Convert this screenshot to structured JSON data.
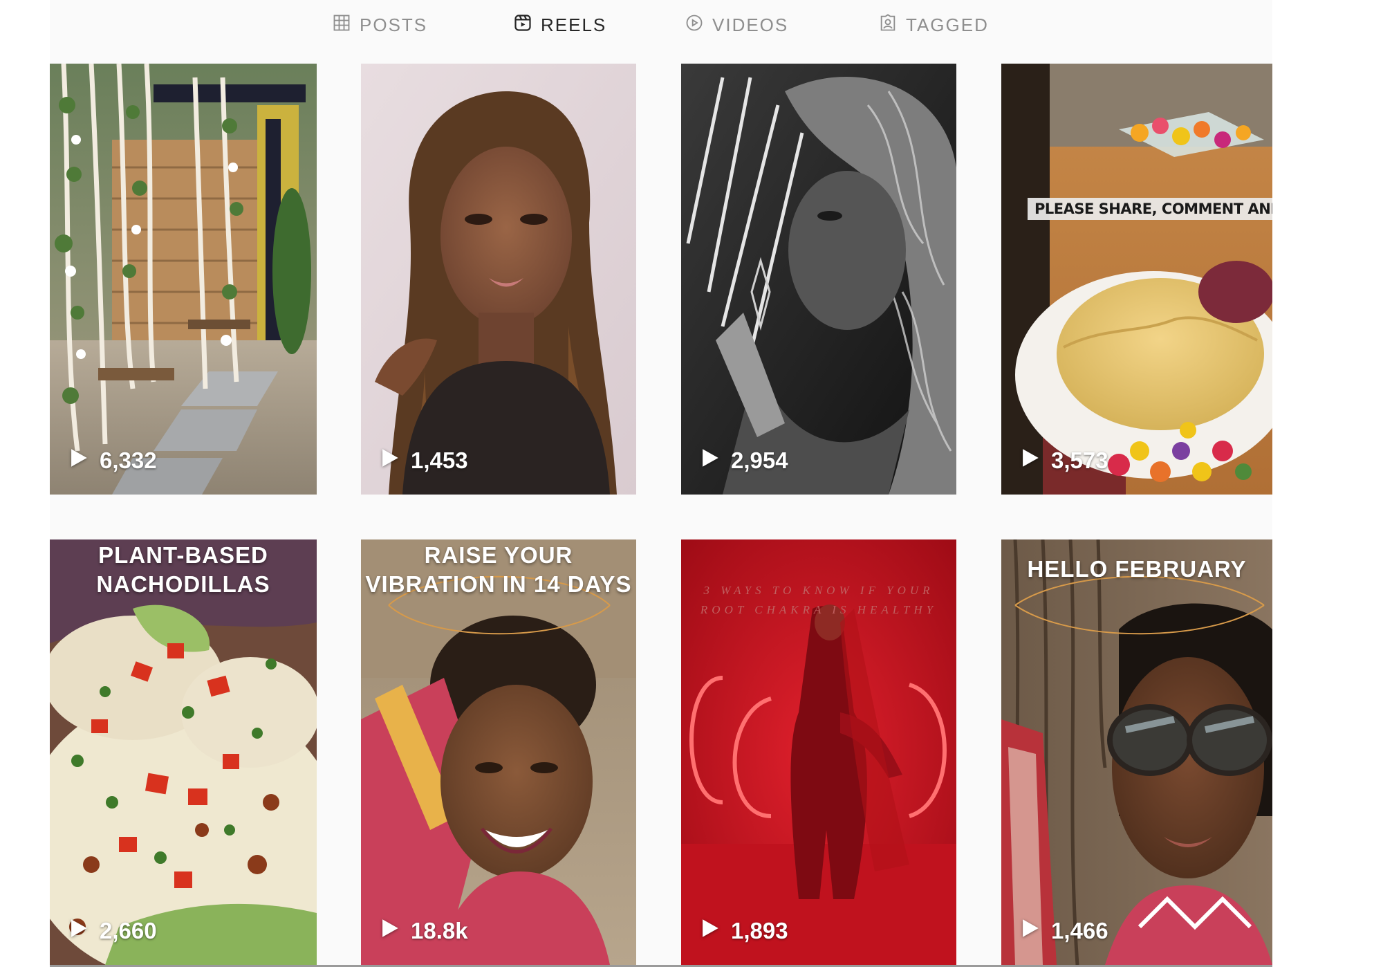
{
  "tabs": [
    {
      "label": "POSTS",
      "icon": "grid-icon",
      "active": false
    },
    {
      "label": "REELS",
      "icon": "reels-icon",
      "active": true
    },
    {
      "label": "VIDEOS",
      "icon": "play-circle-icon",
      "active": false
    },
    {
      "label": "TAGGED",
      "icon": "tagged-person-icon",
      "active": false
    }
  ],
  "reels": [
    {
      "views": "6,332",
      "overlay": ""
    },
    {
      "views": "1,453",
      "overlay": ""
    },
    {
      "views": "2,954",
      "overlay": ""
    },
    {
      "views": "3,573",
      "overlay": "PLEASE SHARE, COMMENT AND SAVE"
    },
    {
      "views": "2,660",
      "overlay": "PLANT-BASED NACHODILLAS"
    },
    {
      "views": "18.8k",
      "overlay": "RAISE YOUR VIBRATION IN 14 DAYS"
    },
    {
      "views": "1,893",
      "overlay": "3 WAYS TO KNOW IF YOUR ROOT CHAKRA IS HEALTHY"
    },
    {
      "views": "1,466",
      "overlay": "HELLO FEBRUARY"
    }
  ],
  "colors": {
    "active_tab": "#262626",
    "inactive_tab": "#8e8e8e",
    "panel_background": "#fafafa"
  }
}
